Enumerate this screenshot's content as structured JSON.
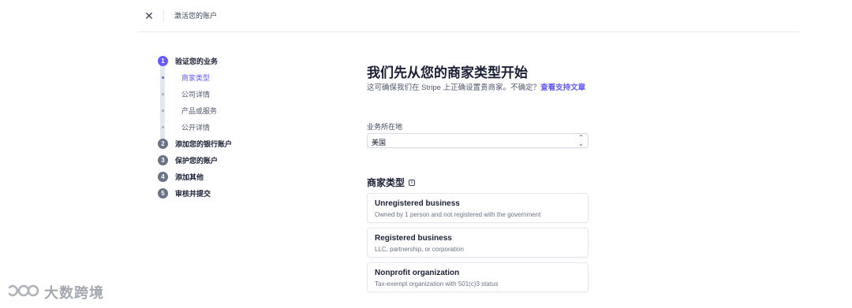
{
  "topbar": {
    "close_glyph": "✕",
    "title": "激活您的账户"
  },
  "steps": [
    {
      "num": "1",
      "label": "验证您的业务",
      "active": true,
      "substeps": [
        {
          "label": "商家类型",
          "active": true
        },
        {
          "label": "公司详情",
          "active": false
        },
        {
          "label": "产品或服务",
          "active": false
        },
        {
          "label": "公开详情",
          "active": false
        }
      ]
    },
    {
      "num": "2",
      "label": "添加您的银行账户",
      "active": false
    },
    {
      "num": "3",
      "label": "保护您的账户",
      "active": false
    },
    {
      "num": "4",
      "label": "添加其他",
      "active": false
    },
    {
      "num": "5",
      "label": "审核并提交",
      "active": false
    }
  ],
  "main": {
    "heading": "我们先从您的商家类型开始",
    "subtitle_text": "这可确保我们在 Stripe 上正确设置贵商家。不确定？",
    "subtitle_link": "查看支持文章",
    "location_label": "业务所在地",
    "location_value": "美国",
    "business_type_title": "商家类型",
    "info_icon_glyph": "i",
    "options": [
      {
        "title": "Unregistered business",
        "desc": "Owned by 1 person and not registered with the government"
      },
      {
        "title": "Registered business",
        "desc": "LLC, partnership, or corporation"
      },
      {
        "title": "Nonprofit organization",
        "desc": "Tax-exempt organization with 501(c)3 status"
      }
    ]
  },
  "watermark": {
    "text": "大数跨境"
  },
  "colors": {
    "accent": "#635bff",
    "inactive_step": "#697386",
    "border": "#e3e8ee"
  },
  "icons": [
    "close-icon",
    "info-icon",
    "select-arrows-icon",
    "watermark-logo-icon"
  ]
}
